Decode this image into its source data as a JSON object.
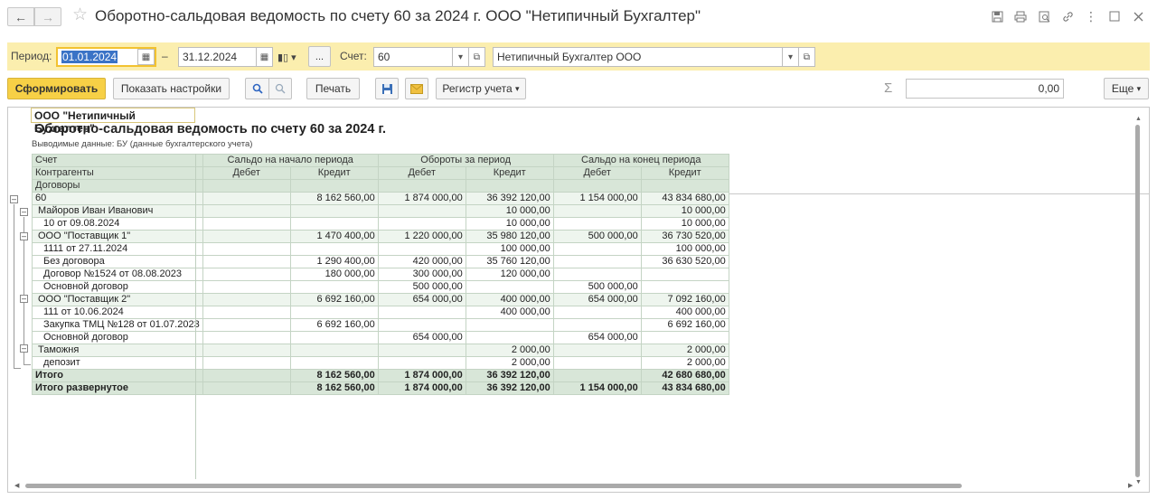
{
  "header": {
    "title": "Оборотно-сальдовая ведомость по счету 60 за 2024 г. ООО \"Нетипичный Бухгалтер\"",
    "icons": [
      "save-icon",
      "print-icon",
      "preview-icon",
      "link-icon",
      "more-icon",
      "maximize-icon",
      "close-icon"
    ]
  },
  "filters": {
    "period_label": "Период:",
    "date_from": "01.01.2024",
    "date_to": "31.12.2024",
    "dash": "–",
    "ellipsis": "...",
    "account_label": "Счет:",
    "account": "60",
    "organization": "Нетипичный Бухгалтер ООО"
  },
  "toolbar": {
    "generate": "Сформировать",
    "settings": "Показать настройки",
    "print": "Печать",
    "register": "Регистр учета",
    "sum_value": "0,00",
    "more": "Еще"
  },
  "report": {
    "org": "ООО \"Нетипичный Бухгалтер\"",
    "title": "Оборотно-сальдовая ведомость по счету 60 за 2024 г.",
    "subtitle": "Выводимые данные: БУ (данные бухгалтерского учета)",
    "col_account": "Счет",
    "col_counterparty": "Контрагенты",
    "col_contracts": "Договоры",
    "grp_open": "Сальдо на начало периода",
    "grp_turn": "Обороты за период",
    "grp_close": "Сальдо на конец периода",
    "debit": "Дебет",
    "credit": "Кредит",
    "rows": [
      {
        "name": "60",
        "level": 0,
        "style": "g",
        "v": [
          "",
          "8 162 560,00",
          "1 874 000,00",
          "36 392 120,00",
          "1 154 000,00",
          "43 834 680,00"
        ]
      },
      {
        "name": "Майоров Иван Иванович",
        "level": 1,
        "style": "g",
        "v": [
          "",
          "",
          "",
          "10 000,00",
          "",
          "10 000,00"
        ]
      },
      {
        "name": "10 от 09.08.2024",
        "level": 2,
        "style": "",
        "v": [
          "",
          "",
          "",
          "10 000,00",
          "",
          "10 000,00"
        ]
      },
      {
        "name": "ООО \"Поставщик 1\"",
        "level": 1,
        "style": "g",
        "v": [
          "",
          "1 470 400,00",
          "1 220 000,00",
          "35 980 120,00",
          "500 000,00",
          "36 730 520,00"
        ]
      },
      {
        "name": "1111 от 27.11.2024",
        "level": 2,
        "style": "",
        "v": [
          "",
          "",
          "",
          "100 000,00",
          "",
          "100 000,00"
        ]
      },
      {
        "name": "Без договора",
        "level": 2,
        "style": "",
        "v": [
          "",
          "1 290 400,00",
          "420 000,00",
          "35 760 120,00",
          "",
          "36 630 520,00"
        ]
      },
      {
        "name": "Договор №1524 от 08.08.2023",
        "level": 2,
        "style": "",
        "v": [
          "",
          "180 000,00",
          "300 000,00",
          "120 000,00",
          "",
          ""
        ]
      },
      {
        "name": "Основной договор",
        "level": 2,
        "style": "",
        "v": [
          "",
          "",
          "500 000,00",
          "",
          "500 000,00",
          ""
        ]
      },
      {
        "name": "ООО \"Поставщик 2\"",
        "level": 1,
        "style": "g",
        "v": [
          "",
          "6 692 160,00",
          "654 000,00",
          "400 000,00",
          "654 000,00",
          "7 092 160,00"
        ]
      },
      {
        "name": "111 от 10.06.2024",
        "level": 2,
        "style": "",
        "v": [
          "",
          "",
          "",
          "400 000,00",
          "",
          "400 000,00"
        ]
      },
      {
        "name": "Закупка ТМЦ №128 от 01.07.2023",
        "level": 2,
        "style": "",
        "v": [
          "",
          "6 692 160,00",
          "",
          "",
          "",
          "6 692 160,00"
        ]
      },
      {
        "name": "Основной договор",
        "level": 2,
        "style": "",
        "v": [
          "",
          "",
          "654 000,00",
          "",
          "654 000,00",
          ""
        ]
      },
      {
        "name": "Таможня",
        "level": 1,
        "style": "g",
        "v": [
          "",
          "",
          "",
          "2 000,00",
          "",
          "2 000,00"
        ]
      },
      {
        "name": "депозит",
        "level": 2,
        "style": "",
        "v": [
          "",
          "",
          "",
          "2 000,00",
          "",
          "2 000,00"
        ]
      },
      {
        "name": "Итого",
        "level": 0,
        "style": "t",
        "v": [
          "",
          "8 162 560,00",
          "1 874 000,00",
          "36 392 120,00",
          "",
          "42 680 680,00"
        ]
      },
      {
        "name": "Итого развернутое",
        "level": 0,
        "style": "t",
        "v": [
          "",
          "8 162 560,00",
          "1 874 000,00",
          "36 392 120,00",
          "1 154 000,00",
          "43 834 680,00"
        ]
      }
    ]
  }
}
